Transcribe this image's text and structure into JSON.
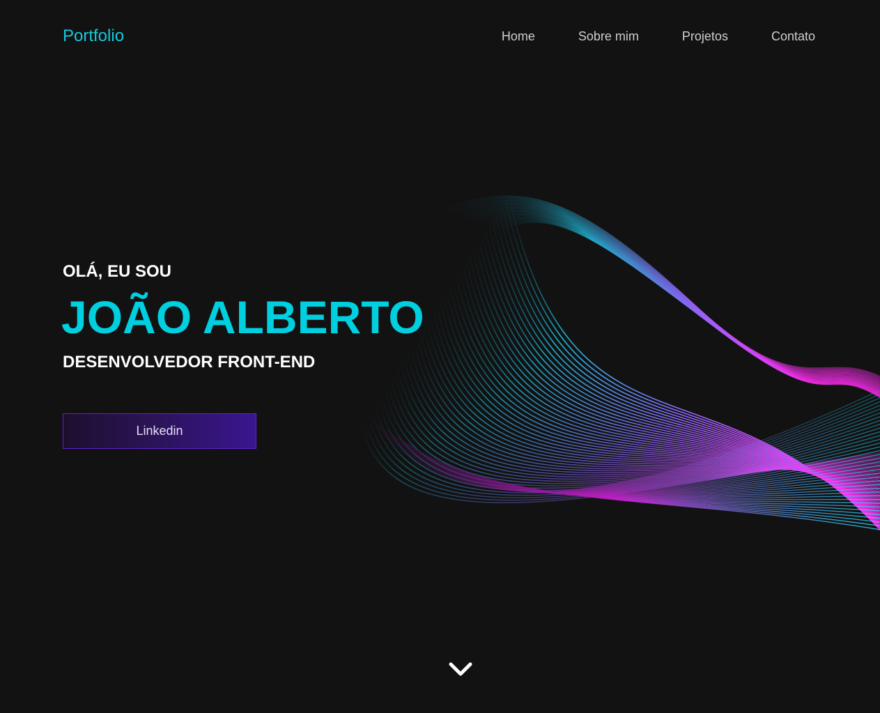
{
  "header": {
    "brand": "Portfolio",
    "nav": [
      {
        "label": "Home"
      },
      {
        "label": "Sobre mim"
      },
      {
        "label": "Projetos"
      },
      {
        "label": "Contato"
      }
    ]
  },
  "hero": {
    "greeting": "OLÁ, EU SOU",
    "name": "JOÃO ALBERTO",
    "role": "DESENVOLVEDOR FRONT-END",
    "cta_label": "Linkedin"
  },
  "icons": {
    "scroll_down": "chevron-down-icon"
  },
  "colors": {
    "background": "#121212",
    "accent": "#00cfe0",
    "button": "#3a1590",
    "wave_cyan": "#1fe0ff",
    "wave_purple": "#8a6cff",
    "wave_magenta": "#ff2cf0"
  }
}
